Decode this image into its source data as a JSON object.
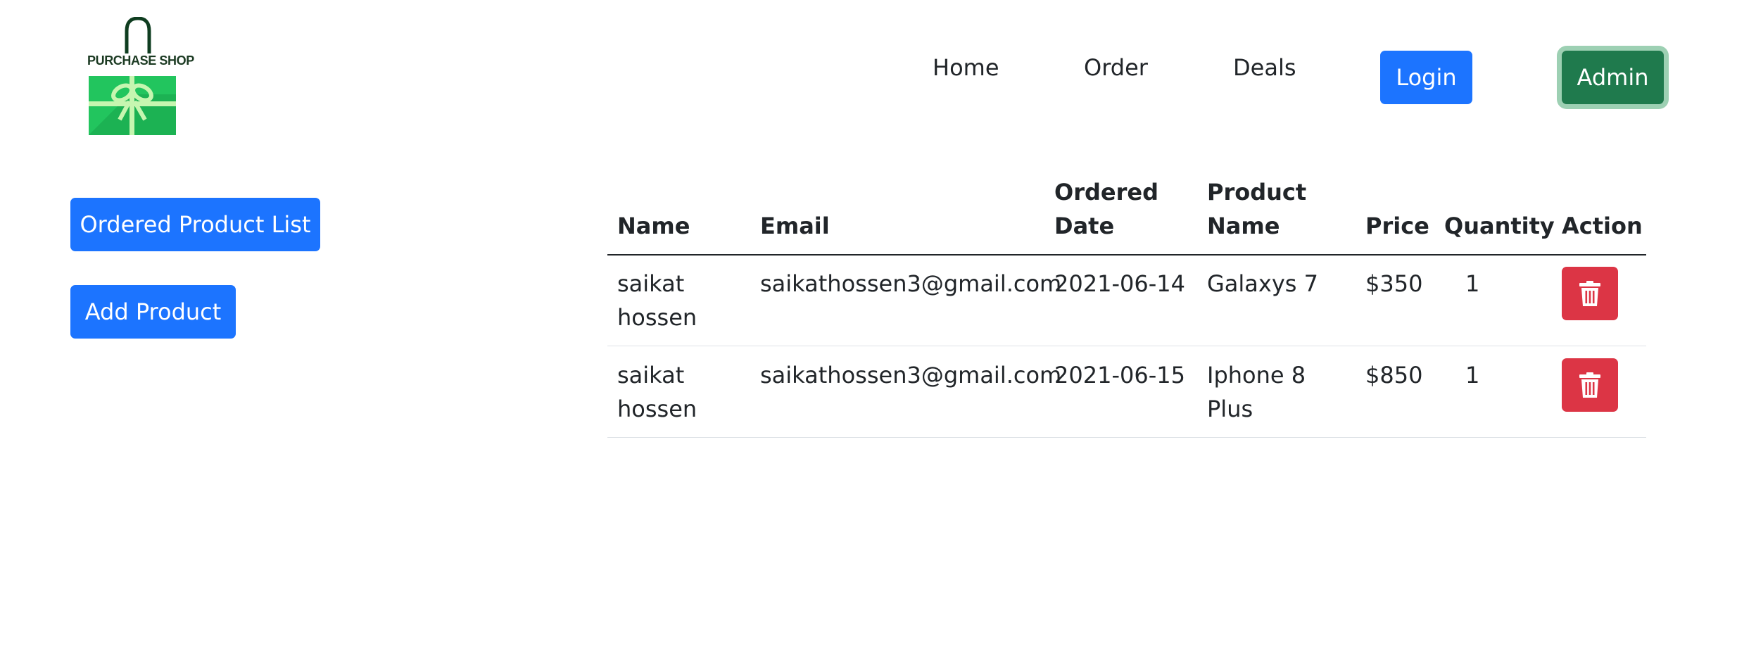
{
  "brand": {
    "name": "PURCHASE SHOP",
    "logo_colors": {
      "bag": "#22c55e",
      "bag_dark": "#17a34a",
      "ribbon": "#c6f6b0",
      "handle": "#0f3d20"
    }
  },
  "nav": {
    "links": [
      {
        "label": "Home"
      },
      {
        "label": "Order"
      },
      {
        "label": "Deals"
      }
    ],
    "login_label": "Login",
    "admin_label": "Admin"
  },
  "sidebar": {
    "ordered_list_label": "Ordered Product List",
    "add_product_label": "Add Product"
  },
  "table": {
    "columns": [
      {
        "line1": "",
        "line2": "Name"
      },
      {
        "line1": "",
        "line2": "Email"
      },
      {
        "line1": "Ordered",
        "line2": "Date"
      },
      {
        "line1": "Product",
        "line2": "Name"
      },
      {
        "line1": "",
        "line2": "Price"
      },
      {
        "line1": "",
        "line2": "Quantity"
      },
      {
        "line1": "",
        "line2": "Action"
      }
    ],
    "rows": [
      {
        "name_line1": "saikat",
        "name_line2": "hossen",
        "email": "saikathossen3@gmail.com",
        "date": "2021-06-14",
        "product_line1": "Galaxys 7",
        "product_line2": "",
        "price": "$350",
        "quantity": "1",
        "action_icon": "trash-icon"
      },
      {
        "name_line1": "saikat",
        "name_line2": "hossen",
        "email": "saikathossen3@gmail.com",
        "date": "2021-06-15",
        "product_line1": "Iphone 8",
        "product_line2": "Plus",
        "price": "$850",
        "quantity": "1",
        "action_icon": "trash-icon"
      }
    ]
  },
  "colors": {
    "primary": "#1c74ff",
    "success": "#1f7a4d",
    "danger": "#dc3545",
    "text": "#212529"
  }
}
